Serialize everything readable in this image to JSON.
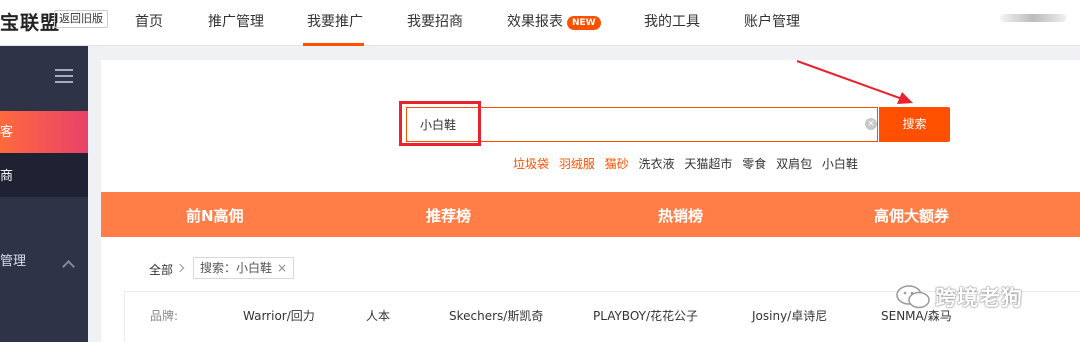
{
  "header": {
    "logo": "宝联盟",
    "old_version": "返回旧版",
    "nav": [
      "首页",
      "推广管理",
      "我要推广",
      "我要招商",
      "效果报表",
      "我的工具",
      "账户管理"
    ],
    "new_badge": "NEW",
    "active_nav": "我要推广"
  },
  "sidebar": {
    "active_item": "客",
    "sub_item": "商",
    "section_label": "管理"
  },
  "search": {
    "value": "小白鞋",
    "button": "搜索",
    "hot_words": [
      {
        "text": "垃圾袋",
        "highlight": true
      },
      {
        "text": "羽绒服",
        "highlight": true
      },
      {
        "text": "猫砂",
        "highlight": true
      },
      {
        "text": "洗衣液",
        "highlight": false
      },
      {
        "text": "天猫超市",
        "highlight": false
      },
      {
        "text": "零食",
        "highlight": false
      },
      {
        "text": "双肩包",
        "highlight": false
      },
      {
        "text": "小白鞋",
        "highlight": false
      }
    ]
  },
  "tabs": [
    "前N高佣",
    "推荐榜",
    "热销榜",
    "高佣大额券"
  ],
  "filter": {
    "all": "全部",
    "tag": "搜索：小白鞋"
  },
  "brands": {
    "label": "品牌:",
    "items": [
      "Warrior/回力",
      "人本",
      "Skechers/斯凯奇",
      "PLAYBOY/花花公子",
      "Josiny/卓诗尼",
      "SENMA/森马"
    ]
  },
  "watermark": "跨境老狗",
  "colors": {
    "accent": "#ff5000",
    "tab_bar": "#ff7e47",
    "sidebar": "#2e3347",
    "annotation": "#e8232e"
  }
}
